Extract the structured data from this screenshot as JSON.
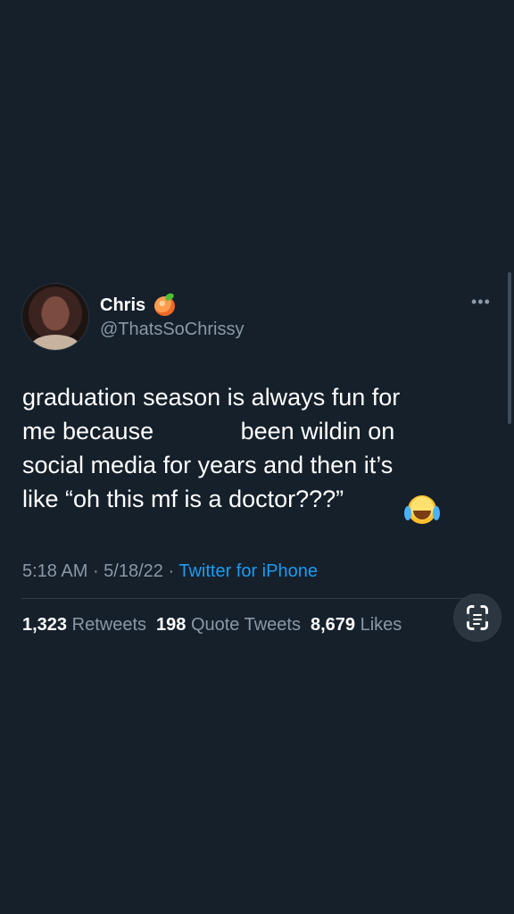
{
  "tweet": {
    "author_name": "Chris",
    "handle": "@ThatsSoChrissy",
    "more_icon": "more-horizontal-icon",
    "text": "graduation season is always fun for\nme because             been wildin on\nsocial media for years and then it’s\nlike “oh this mf is a doctor???” ",
    "emoji": "crying-laughing-face-icon",
    "time": "5:18 AM",
    "date": "5/18/22",
    "source": "Twitter for iPhone",
    "separator": " · "
  },
  "stats": {
    "retweets_value": "1,323",
    "retweets_label": "Retweets",
    "quote_tweets_value": "198",
    "quote_tweets_label": "Quote Tweets",
    "likes_value": "8,679",
    "likes_label": "Likes"
  },
  "overlay": {
    "scan_icon": "text-scan-icon"
  },
  "colors": {
    "background": "#15202b",
    "primary_text": "#ffffff",
    "secondary_text": "#8b98a5",
    "link": "#1d9bf0",
    "divider": "#2f3b47"
  }
}
